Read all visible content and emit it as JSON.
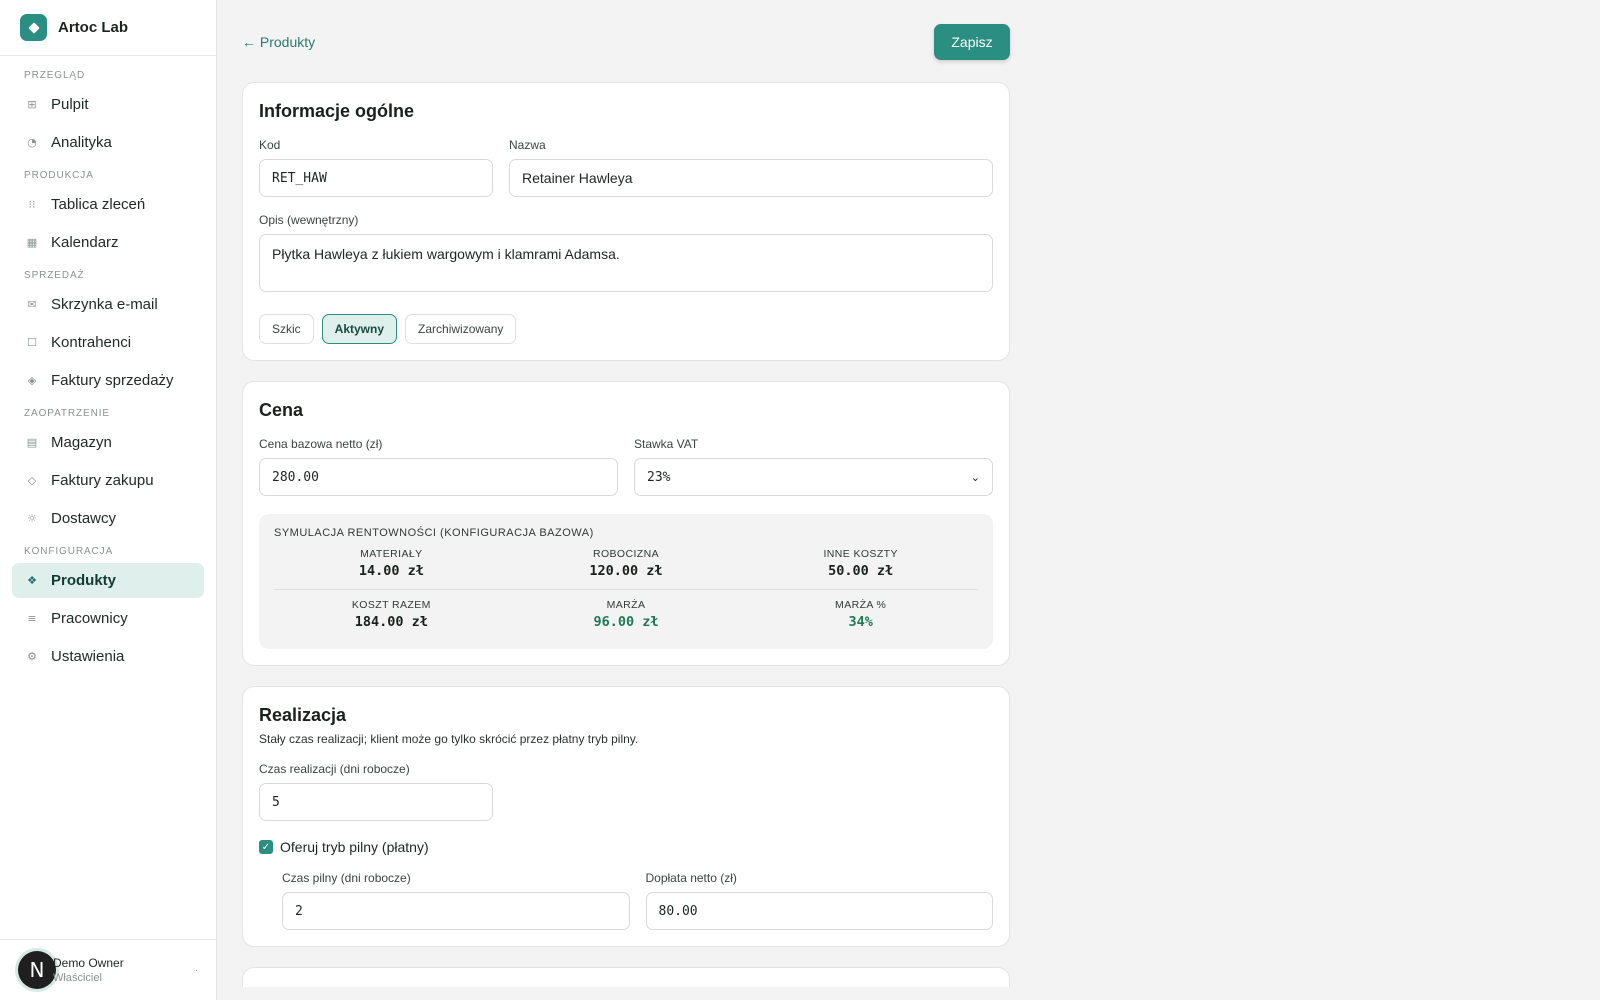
{
  "brand": {
    "name": "Artoc Lab"
  },
  "sidebar": {
    "groups": [
      {
        "label": "PRZEGLĄD",
        "items": [
          {
            "label": "Pulpit",
            "icon": "grid-icon"
          },
          {
            "label": "Analityka",
            "icon": "pie-chart-icon"
          }
        ]
      },
      {
        "label": "PRODUKCJA",
        "items": [
          {
            "label": "Tablica zleceń",
            "icon": "kanban-icon"
          },
          {
            "label": "Kalendarz",
            "icon": "calendar-icon"
          }
        ]
      },
      {
        "label": "SPRZEDAŻ",
        "items": [
          {
            "label": "Skrzynka e-mail",
            "icon": "mail-icon"
          },
          {
            "label": "Kontrahenci",
            "icon": "contacts-icon"
          },
          {
            "label": "Faktury sprzedaży",
            "icon": "invoice-icon"
          }
        ]
      },
      {
        "label": "ZAOPATRZENIE",
        "items": [
          {
            "label": "Magazyn",
            "icon": "warehouse-icon"
          },
          {
            "label": "Faktury zakupu",
            "icon": "purchase-invoice-icon"
          },
          {
            "label": "Dostawcy",
            "icon": "suppliers-icon"
          }
        ]
      },
      {
        "label": "KONFIGURACJA",
        "items": [
          {
            "label": "Produkty",
            "icon": "products-icon",
            "active": true
          },
          {
            "label": "Pracownicy",
            "icon": "employees-icon"
          },
          {
            "label": "Ustawienia",
            "icon": "settings-icon"
          }
        ]
      }
    ]
  },
  "user": {
    "avatar": "N",
    "name": "Demo Owner",
    "role": "Właściciel"
  },
  "topbar": {
    "back_label": "← Produkty",
    "save_label": "Zapisz"
  },
  "general": {
    "title": "Informacje ogólne",
    "code_label": "Kod",
    "code_value": "RET_HAW",
    "name_label": "Nazwa",
    "name_value": "Retainer Hawleya",
    "desc_label": "Opis (wewnętrzny)",
    "desc_value": "Płytka Hawleya z łukiem wargowym i klamrami Adamsa.",
    "statuses": [
      "Szkic",
      "Aktywny",
      "Zarchiwizowany"
    ],
    "active_status": "Aktywny"
  },
  "price": {
    "title": "Cena",
    "base_label": "Cena bazowa netto (zł)",
    "base_value": "280.00",
    "vat_label": "Stawka VAT",
    "vat_value": "23%",
    "sim": {
      "title": "SYMULACJA RENTOWNOŚCI (KONFIGURACJA BAZOWA)",
      "materials_label": "MATERIAŁY",
      "materials_value": "14.00 zł",
      "labor_label": "ROBOCIZNA",
      "labor_value": "120.00 zł",
      "other_label": "INNE KOSZTY",
      "other_value": "50.00 zł",
      "total_label": "KOSZT RAZEM",
      "total_value": "184.00 zł",
      "margin_label": "MARŻA",
      "margin_value": "96.00 zł",
      "margin_pct_label": "MARŻA %",
      "margin_pct_value": "34%"
    }
  },
  "fulfillment": {
    "title": "Realizacja",
    "desc": "Stały czas realizacji; klient może go tylko skrócić przez płatny tryb pilny.",
    "time_label": "Czas realizacji (dni robocze)",
    "time_value": "5",
    "urgent_label": "Oferuj tryb pilny (płatny)",
    "urgent_checked": true,
    "urgent_time_label": "Czas pilny (dni robocze)",
    "urgent_time_value": "2",
    "surcharge_label": "Dopłata netto (zł)",
    "surcharge_value": "80.00"
  },
  "colors": {
    "accent": "#2a8f82",
    "active_bg": "#dff0ec",
    "margin_green": "#1e7a54"
  }
}
